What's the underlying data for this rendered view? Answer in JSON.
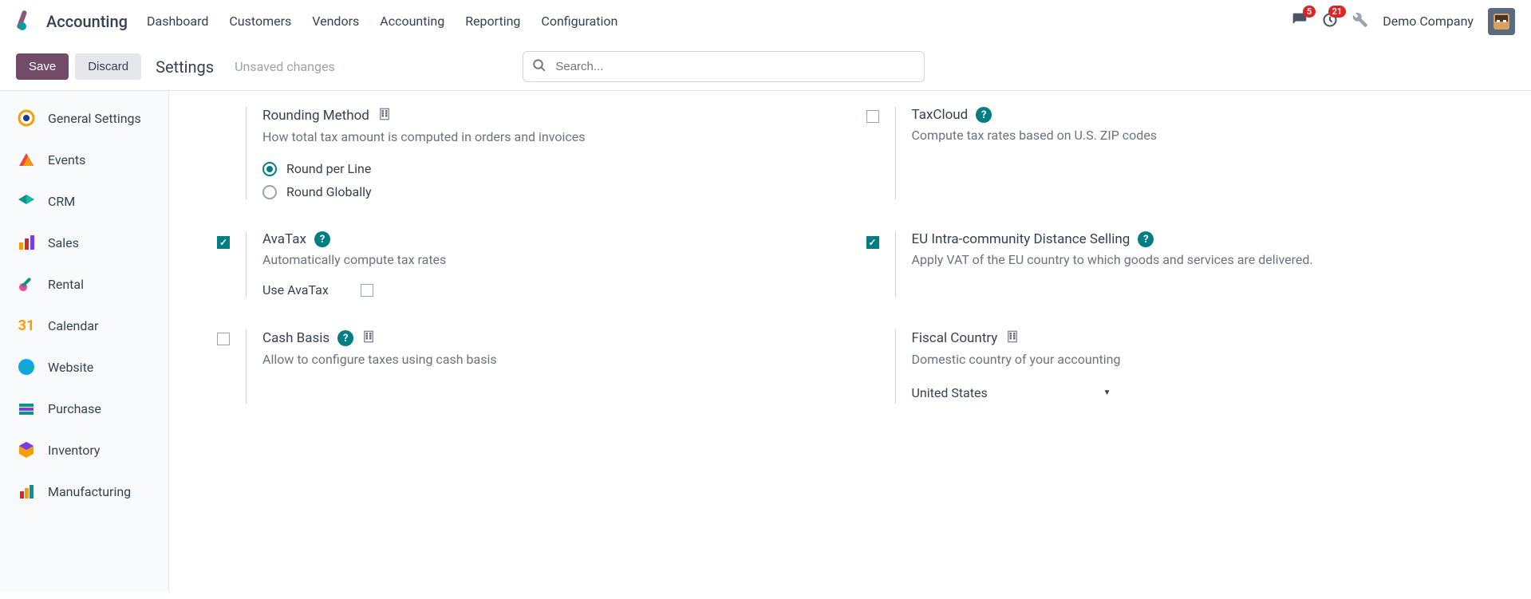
{
  "header": {
    "app_title": "Accounting",
    "nav": [
      "Dashboard",
      "Customers",
      "Vendors",
      "Accounting",
      "Reporting",
      "Configuration"
    ],
    "messages_badge": "5",
    "activities_badge": "21",
    "company": "Demo Company"
  },
  "controls": {
    "save": "Save",
    "discard": "Discard",
    "breadcrumb": "Settings",
    "unsaved": "Unsaved changes",
    "search_placeholder": "Search..."
  },
  "sidebar": {
    "items": [
      {
        "label": "General Settings"
      },
      {
        "label": "Events"
      },
      {
        "label": "CRM"
      },
      {
        "label": "Sales"
      },
      {
        "label": "Rental"
      },
      {
        "label": "Calendar"
      },
      {
        "label": "Website"
      },
      {
        "label": "Purchase"
      },
      {
        "label": "Inventory"
      },
      {
        "label": "Manufacturing"
      }
    ]
  },
  "settings": {
    "rounding": {
      "title": "Rounding Method",
      "desc": "How total tax amount is computed in orders and invoices",
      "opt1": "Round per Line",
      "opt2": "Round Globally",
      "selected": "opt1"
    },
    "taxcloud": {
      "title": "TaxCloud",
      "desc": "Compute tax rates based on U.S. ZIP codes",
      "checked": false
    },
    "avatax": {
      "title": "AvaTax",
      "desc": "Automatically compute tax rates",
      "checked": true,
      "sub_label": "Use AvaTax",
      "sub_checked": false
    },
    "eu": {
      "title": "EU Intra-community Distance Selling",
      "desc": "Apply VAT of the EU country to which goods and services are delivered.",
      "checked": true
    },
    "cashbasis": {
      "title": "Cash Basis",
      "desc": "Allow to configure taxes using cash basis",
      "checked": false
    },
    "fiscal": {
      "title": "Fiscal Country",
      "desc": "Domestic country of your accounting",
      "value": "United States"
    }
  }
}
